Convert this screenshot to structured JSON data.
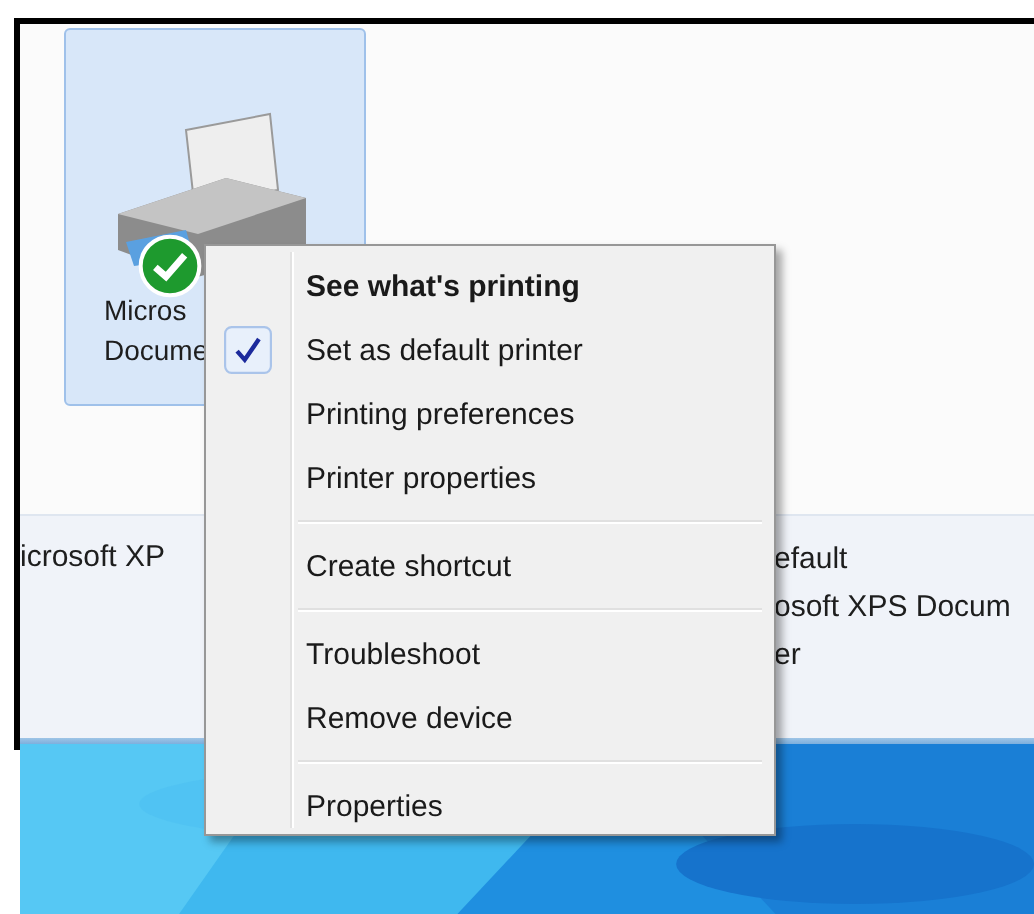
{
  "device": {
    "name_lines": [
      "Micros",
      "Docume"
    ],
    "selected": true,
    "is_default": true
  },
  "details": {
    "name": "icrosoft XP",
    "fields": [
      "efault",
      "osoft XPS Docum",
      "er"
    ]
  },
  "context_menu": {
    "groups": [
      [
        {
          "label": "See what's printing",
          "default": true,
          "checked": false
        },
        {
          "label": "Set as default printer",
          "default": false,
          "checked": true
        },
        {
          "label": "Printing preferences",
          "default": false,
          "checked": false
        },
        {
          "label": "Printer properties",
          "default": false,
          "checked": false
        }
      ],
      [
        {
          "label": "Create shortcut",
          "default": false,
          "checked": false
        }
      ],
      [
        {
          "label": "Troubleshoot",
          "default": false,
          "checked": false
        },
        {
          "label": "Remove device",
          "default": false,
          "checked": false
        }
      ],
      [
        {
          "label": "Properties",
          "default": false,
          "checked": false
        }
      ]
    ]
  }
}
